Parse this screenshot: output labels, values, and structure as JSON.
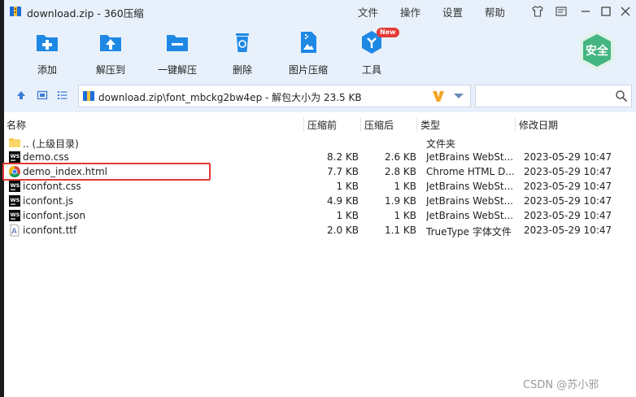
{
  "window": {
    "title": "download.zip - 360压缩",
    "menus": [
      "文件",
      "操作",
      "设置",
      "帮助"
    ]
  },
  "toolbar": {
    "add": "添加",
    "extract_to": "解压到",
    "one_click_extract": "一键解压",
    "delete": "删除",
    "image_compress": "图片压缩",
    "tools": "工具",
    "new_badge": "New",
    "safe": "安全"
  },
  "addressbar": {
    "path": "download.zip\\font_mbckg2bw4ep - 解包大小为 23.5 KB",
    "search_placeholder": ""
  },
  "columns": {
    "name": "名称",
    "compressed": "压缩前",
    "original": "压缩后",
    "type": "类型",
    "modified": "修改日期"
  },
  "files": [
    {
      "name": ".. (上级目录)",
      "csize": "",
      "osize": "",
      "type": "文件夹",
      "date": "",
      "icon": "folder-icon"
    },
    {
      "name": "demo.css",
      "csize": "8.2 KB",
      "osize": "2.6 KB",
      "type": "JetBrains WebSt...",
      "date": "2023-05-29 10:47",
      "icon": "webstorm-icon"
    },
    {
      "name": "demo_index.html",
      "csize": "7.7 KB",
      "osize": "2.8 KB",
      "type": "Chrome HTML D...",
      "date": "2023-05-29 10:47",
      "icon": "chrome-icon"
    },
    {
      "name": "iconfont.css",
      "csize": "1 KB",
      "osize": "1 KB",
      "type": "JetBrains WebSt...",
      "date": "2023-05-29 10:47",
      "icon": "webstorm-icon"
    },
    {
      "name": "iconfont.js",
      "csize": "4.9 KB",
      "osize": "1.9 KB",
      "type": "JetBrains WebSt...",
      "date": "2023-05-29 10:47",
      "icon": "webstorm-icon"
    },
    {
      "name": "iconfont.json",
      "csize": "1 KB",
      "osize": "1 KB",
      "type": "JetBrains WebSt...",
      "date": "2023-05-29 10:47",
      "icon": "webstorm-icon"
    },
    {
      "name": "iconfont.ttf",
      "csize": "2.0 KB",
      "osize": "1.1 KB",
      "type": "TrueType 字体文件",
      "date": "2023-05-29 10:47",
      "icon": "font-file-icon"
    }
  ],
  "watermark": "CSDN @苏小邪",
  "colors": {
    "chrome_bg": "#e8f1fb",
    "accent_blue": "#1e88e5",
    "safe_green": "#43b581",
    "highlight_red": "#e53935"
  }
}
